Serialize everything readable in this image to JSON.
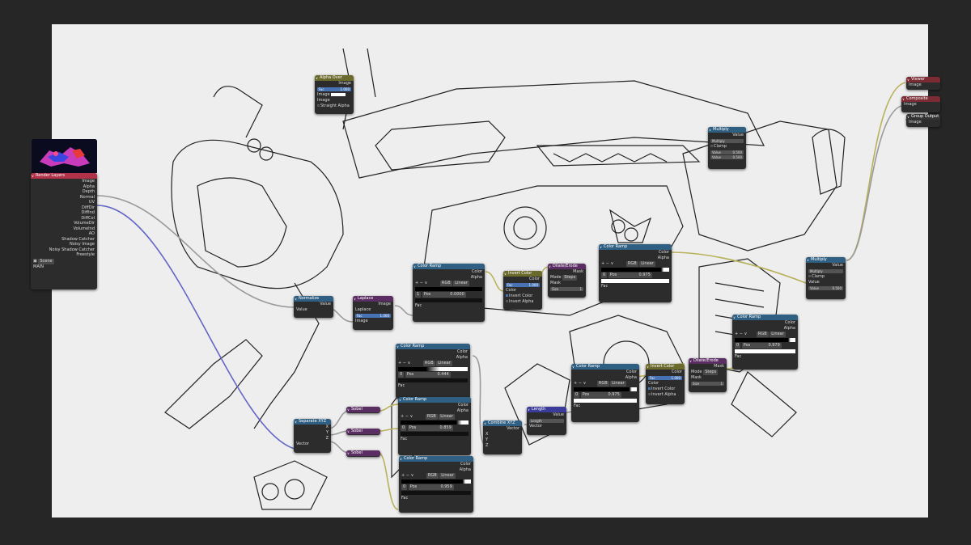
{
  "render_layers": {
    "title": "Render Layers",
    "outputs": [
      "Image",
      "Alpha",
      "Depth",
      "Normal",
      "UV",
      "DiffDir",
      "DiffInd",
      "DiffCol",
      "VolumeDir",
      "VolumeInd",
      "AO",
      "Shadow Catcher",
      "Noisy Image",
      "Noisy Shadow Catcher",
      "Freestyle"
    ],
    "scene": "Scene",
    "layer": "MAIN"
  },
  "alpha_over": {
    "title": "Alpha Over",
    "out": "Image",
    "fac_label": "Fac",
    "fac": "1.000",
    "in1": "Image",
    "in2": "Image",
    "straight_alpha": "Straight Alpha"
  },
  "normalize": {
    "title": "Normalize",
    "out": "Value",
    "in": "Value"
  },
  "laplace": {
    "title": "Laplace",
    "out": "Image",
    "select": "Laplace",
    "fac_label": "Fac",
    "fac": "1.000",
    "in": "Image"
  },
  "ramp_top": {
    "title": "Color Ramp",
    "color": "Color",
    "alpha": "Alpha",
    "mode": "RGB",
    "interp": "Linear",
    "index": "1",
    "pos_label": "Pos",
    "pos": "0.0000",
    "fac": "Fac"
  },
  "invert1": {
    "title": "Invert Color",
    "out": "Color",
    "fac_label": "Fac",
    "fac": "1.000",
    "in": "Color",
    "inv_color": "Invert Color",
    "inv_alpha": "Invert Alpha"
  },
  "dilate1": {
    "title": "Dilate/Erode",
    "out": "Mask",
    "mode_label": "Mode",
    "mode": "Steps",
    "mask": "Mask",
    "size_label": "Size",
    "size": "1"
  },
  "ramp_mid": {
    "title": "Color Ramp",
    "color": "Color",
    "alpha": "Alpha",
    "mode": "RGB",
    "interp": "Linear",
    "index": "0",
    "pos_label": "Pos",
    "pos": "0.975",
    "fac": "Fac"
  },
  "multiply1": {
    "title": "Multiply",
    "out": "Value",
    "op": "Multiply",
    "clamp": "Clamp",
    "v1_label": "Value",
    "v1": "0.500",
    "v2_label": "Value",
    "v2": "0.500"
  },
  "multiply2": {
    "title": "Multiply",
    "out": "Value",
    "op": "Multiply",
    "clamp": "Clamp",
    "in": "Value",
    "v_label": "Value",
    "v": "0.500"
  },
  "viewer": {
    "title": "Viewer",
    "in": "Image"
  },
  "composite": {
    "title": "Composite",
    "in": "Image"
  },
  "group_output": {
    "title": "Group Output",
    "in": "Image"
  },
  "ramp_right": {
    "title": "Color Ramp",
    "color": "Color",
    "alpha": "Alpha",
    "mode": "RGB",
    "interp": "Linear",
    "index": "0",
    "pos_label": "Pos",
    "pos": "0.979",
    "fac": "Fac"
  },
  "dilate2": {
    "title": "Dilate/Erode",
    "out": "Mask",
    "mode_label": "Mode",
    "mode": "Steps",
    "mask": "Mask",
    "size_label": "Size",
    "size": "1"
  },
  "invert2": {
    "title": "Invert Color",
    "out": "Color",
    "fac_label": "Fac",
    "fac": "1.000",
    "in": "Color",
    "inv_color": "Invert Color",
    "inv_alpha": "Invert Alpha"
  },
  "ramp_lowmid": {
    "title": "Color Ramp",
    "color": "Color",
    "alpha": "Alpha",
    "mode": "RGB",
    "interp": "Linear",
    "index": "0",
    "pos_label": "Pos",
    "pos": "0.975",
    "fac": "Fac"
  },
  "length": {
    "title": "Length",
    "out": "Value",
    "op": "Length",
    "in": "Vector"
  },
  "combine": {
    "title": "Combine XYZ",
    "out": "Vector",
    "x": "X",
    "y": "Y",
    "z": "Z"
  },
  "separate": {
    "title": "Separate XYZ",
    "x": "X",
    "y": "Y",
    "z": "Z",
    "in": "Vector"
  },
  "sobel": {
    "title": "Sobel"
  },
  "ramp_a": {
    "title": "Color Ramp",
    "color": "Color",
    "alpha": "Alpha",
    "mode": "RGB",
    "interp": "Linear",
    "index": "0",
    "pos_label": "Pos",
    "pos": "0.444",
    "fac": "Fac"
  },
  "ramp_b": {
    "title": "Color Ramp",
    "color": "Color",
    "alpha": "Alpha",
    "mode": "RGB",
    "interp": "Linear",
    "index": "0",
    "pos_label": "Pos",
    "pos": "0.859",
    "fac": "Fac"
  },
  "ramp_c": {
    "title": "Color Ramp",
    "color": "Color",
    "alpha": "Alpha",
    "mode": "RGB",
    "interp": "Linear",
    "index": "0",
    "pos_label": "Pos",
    "pos": "0.959",
    "fac": "Fac"
  },
  "ramp_controls": [
    "+",
    "−",
    "∨"
  ],
  "colors": {
    "canvas": "#eeeeee",
    "node_body": "#2c2c2c",
    "header_layers": "#b0334a",
    "header_converter": "#2f5f83",
    "header_color": "#6b6a2d",
    "header_filter": "#5b2e63",
    "header_vector": "#3b3b9b",
    "wire_gray": "#9a9a9a",
    "wire_yellow": "#b8b25c",
    "wire_blue": "#6366c6"
  }
}
